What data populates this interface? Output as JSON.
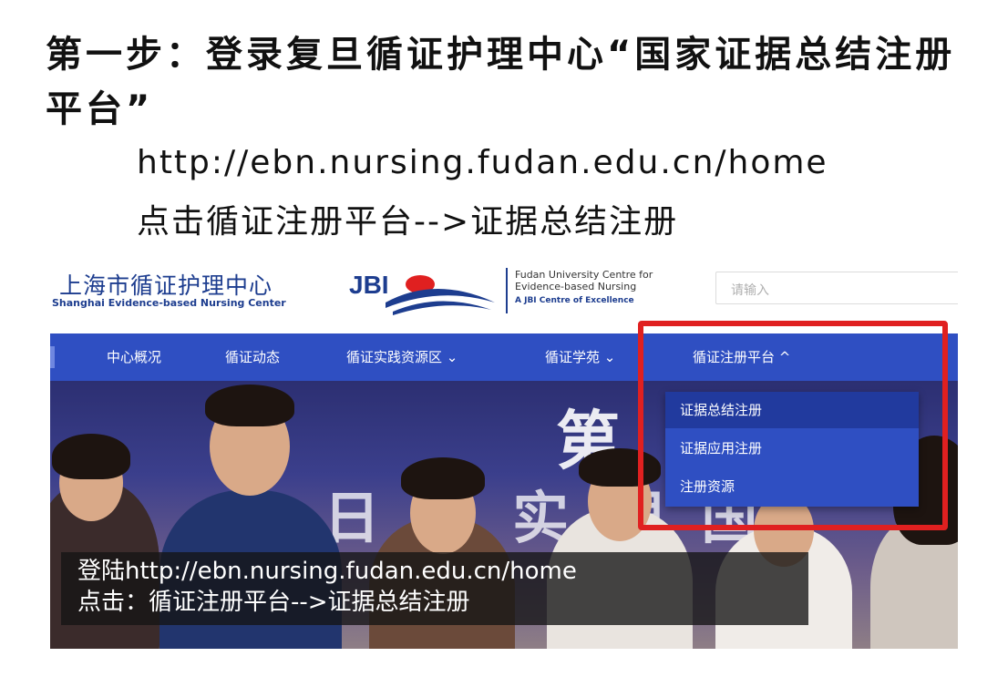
{
  "slide": {
    "heading": "第一步：登录复旦循证护理中心“国家证据总结注册平台”",
    "url": "http://ebn.nursing.fudan.edu.cn/home",
    "instruction": "点击循证注册平台-->证据总结注册"
  },
  "site_header": {
    "logo_cn": "上海市循证护理中心",
    "logo_en": "Shanghai Evidence-based Nursing Center",
    "jbi_text": "JBI",
    "fudan_line1": "Fudan University Centre for",
    "fudan_line2": "Evidence-based Nursing",
    "fudan_line3": "A JBI Centre of Excellence",
    "search_placeholder": "请输入"
  },
  "nav": {
    "items": [
      "中心概况",
      "循证动态",
      "循证实践资源区 ⌄",
      "循证学苑 ⌄",
      "循证注册平台 ^"
    ]
  },
  "dropdown": {
    "items": [
      "证据总结注册",
      "证据应用注册",
      "注册资源"
    ]
  },
  "hero": {
    "stage_text_1": "第",
    "stage_text_2": "日 证 实 理 国"
  },
  "caption": {
    "line1": "登陆http://ebn.nursing.fudan.edu.cn/home",
    "line2": "点击：循证注册平台-->证据总结注册"
  },
  "colors": {
    "nav_bg": "#2f4fc2",
    "dropdown_active": "#213a9e",
    "highlight_box": "#e02020",
    "brand_blue": "#1d3d8f"
  }
}
